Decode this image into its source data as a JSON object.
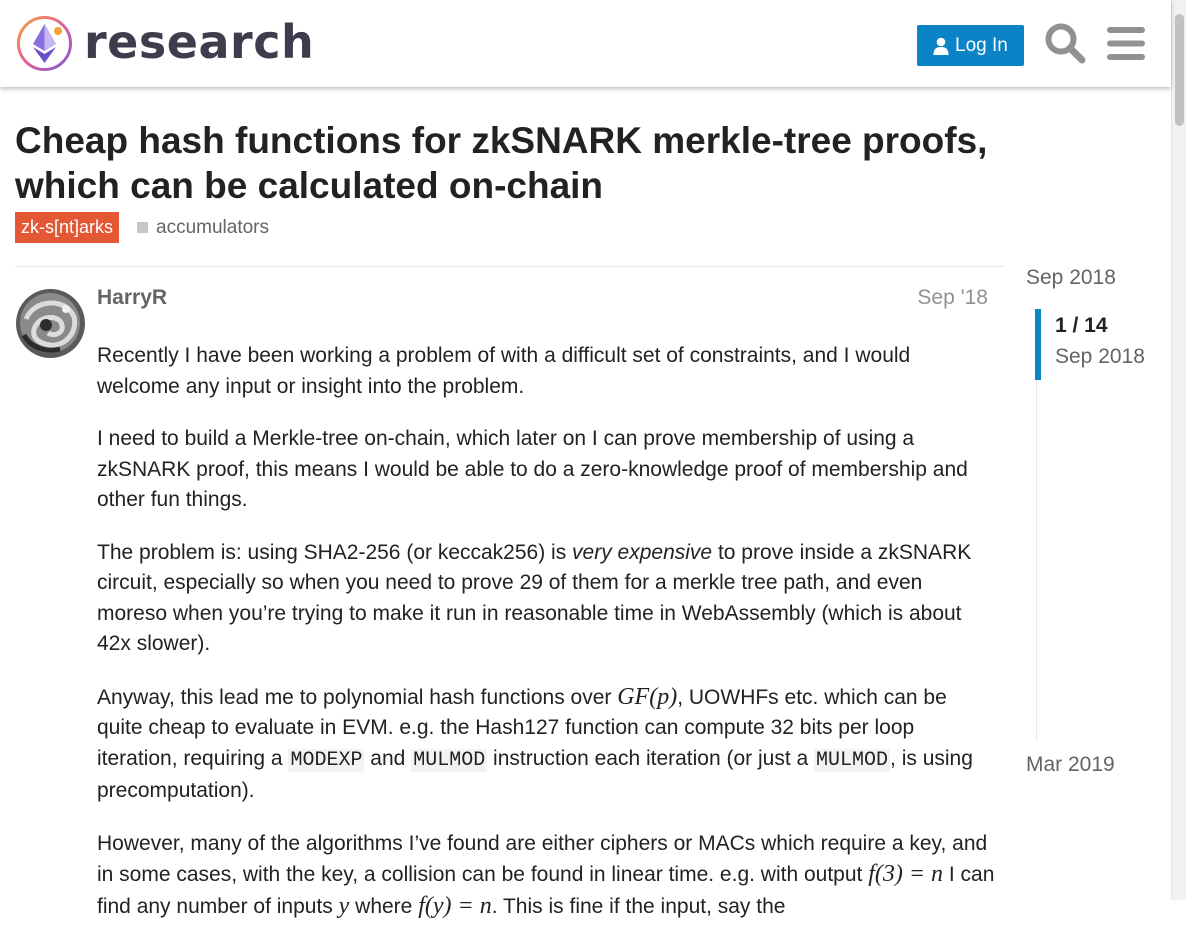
{
  "header": {
    "logo_text": "research",
    "login_label": "Log In",
    "colors": {
      "accent": "#0a84c7",
      "logo_text": "#3d3d4e"
    }
  },
  "topic": {
    "title": "Cheap hash functions for zkSNARK merkle-tree proofs, which can be calculated on-chain",
    "category": "zk-s[nt]arks",
    "tag": "accumulators",
    "colors": {
      "category_bg": "#e45735",
      "tag_square": "#c6c6c6"
    }
  },
  "post": {
    "username": "HarryR",
    "date": "Sep '18",
    "p1": "Recently I have been working a problem of with a difficult set of constraints, and I would welcome any input or insight into the problem.",
    "p2": "I need to build a Merkle-tree on-chain, which later on I can prove membership of using a zkSNARK proof, this means I would be able to do a zero-knowledge proof of membership and other fun things.",
    "p3_a": "The problem is: using SHA2-256 (or keccak256) is ",
    "p3_em": "very expensive",
    "p3_b": " to prove inside a zkSNARK circuit, especially so when you need to prove 29 of them for a merkle tree path, and even moreso when you’re trying to make it run in reasonable time in WebAssembly (which is about 42x slower).",
    "p4_a": "Anyway, this lead me to polynomial hash functions over ",
    "p4_math": "GF(p)",
    "p4_b": ", UOWHFs etc. which can be quite cheap to evaluate in EVM. e.g. the Hash127 function can compute 32 bits per loop iteration, requiring a ",
    "p4_code1": "MODEXP",
    "p4_c": " and ",
    "p4_code2": "MULMOD",
    "p4_d": " instruction each iteration (or just a ",
    "p4_code3": "MULMOD",
    "p4_e": ", is using precomputation).",
    "p5_a": "However, many of the algorithms I’ve found are either ciphers or MACs which require a key, and in some cases, with the key, a collision can be found in linear time. e.g. with output ",
    "p5_math1": "f(3) = n",
    "p5_b": " I can find any number of inputs ",
    "p5_math2": "y",
    "p5_c": " where ",
    "p5_math3": "f(y) = n",
    "p5_d": ". This is fine if the input, say the"
  },
  "timeline": {
    "start_date": "Sep 2018",
    "position": "1 / 14",
    "current_date": "Sep 2018",
    "end_date": "Mar 2019"
  }
}
